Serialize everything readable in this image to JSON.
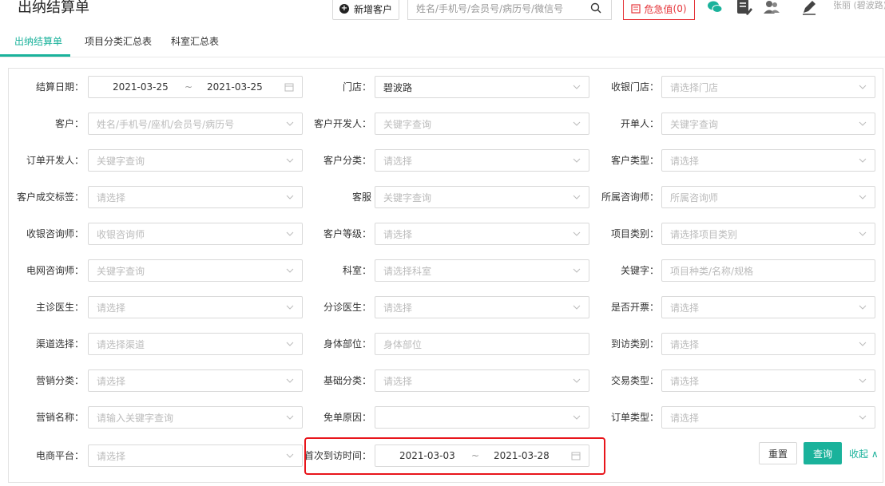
{
  "header": {
    "title": "出纳结算单",
    "new_customer_label": "新增客户",
    "search_placeholder": "姓名/手机号/会员号/病历号/微信号",
    "alert_label": "危急值",
    "alert_count": "0",
    "user_name": "张丽 (碧波路)"
  },
  "tabs": [
    "出纳结算单",
    "项目分类汇总表",
    "科室汇总表"
  ],
  "fields": {
    "settle_date": {
      "label": "结算日期：",
      "start": "2021-03-25",
      "sep": "~",
      "end": "2021-03-25"
    },
    "store": {
      "label": "门店：",
      "value": "碧波路"
    },
    "cashier_store": {
      "label": "收银门店：",
      "placeholder": "请选择门店"
    },
    "customer": {
      "label": "客户：",
      "placeholder": "姓名/手机号/座机/会员号/病历号"
    },
    "customer_developer": {
      "label": "客户开发人：",
      "placeholder": "关键字查询"
    },
    "order_maker": {
      "label": "开单人：",
      "placeholder": "关键字查询"
    },
    "order_developer": {
      "label": "订单开发人：",
      "placeholder": "关键字查询"
    },
    "customer_category": {
      "label": "客户分类：",
      "placeholder": "请选择"
    },
    "customer_type": {
      "label": "客户类型：",
      "placeholder": "请选择"
    },
    "deal_tag": {
      "label": "客户成交标签：",
      "placeholder": "请选择"
    },
    "service": {
      "label": "客服",
      "placeholder": "关键字查询"
    },
    "assigned_consultant": {
      "label": "所属咨询师：",
      "placeholder": "所属咨询师"
    },
    "cashier_consultant": {
      "label": "收银咨询师：",
      "placeholder": "收银咨询师"
    },
    "customer_level": {
      "label": "客户等级：",
      "placeholder": "请选择"
    },
    "item_category": {
      "label": "项目类别：",
      "placeholder": "请选择项目类别"
    },
    "online_consultant": {
      "label": "电网咨询师：",
      "placeholder": "关键字查询"
    },
    "department": {
      "label": "科室：",
      "placeholder": "请选择科室"
    },
    "keyword": {
      "label": "关键字：",
      "placeholder": "项目种类/名称/规格"
    },
    "main_doctor": {
      "label": "主诊医生：",
      "placeholder": "请选择"
    },
    "triage_doctor": {
      "label": "分诊医生：",
      "placeholder": "请选择"
    },
    "invoice": {
      "label": "是否开票：",
      "placeholder": "请选择"
    },
    "channel": {
      "label": "渠道选择：",
      "placeholder": "请选择渠道"
    },
    "body_part": {
      "label": "身体部位：",
      "placeholder": "身体部位"
    },
    "visit_type": {
      "label": "到访类别：",
      "placeholder": "请选择"
    },
    "marketing_category": {
      "label": "营销分类：",
      "placeholder": "请选择"
    },
    "basic_category": {
      "label": "基础分类：",
      "placeholder": "请选择"
    },
    "trade_type": {
      "label": "交易类型：",
      "placeholder": "请选择"
    },
    "marketing_name": {
      "label": "营销名称：",
      "placeholder": "请输入关键字查询"
    },
    "free_reason": {
      "label": "免单原因：",
      "placeholder": ""
    },
    "order_type": {
      "label": "订单类型：",
      "placeholder": "请选择"
    },
    "ecommerce": {
      "label": "电商平台：",
      "placeholder": "请选择"
    },
    "first_visit": {
      "label": "首次到访时间：",
      "start": "2021-03-03",
      "sep": "~",
      "end": "2021-03-28"
    }
  },
  "actions": {
    "reset": "重置",
    "query": "查询",
    "collapse": "收起 ∧"
  },
  "colors": {
    "accent": "#1ab29b",
    "alert": "#e5353a",
    "highlight": "#e8151b"
  }
}
